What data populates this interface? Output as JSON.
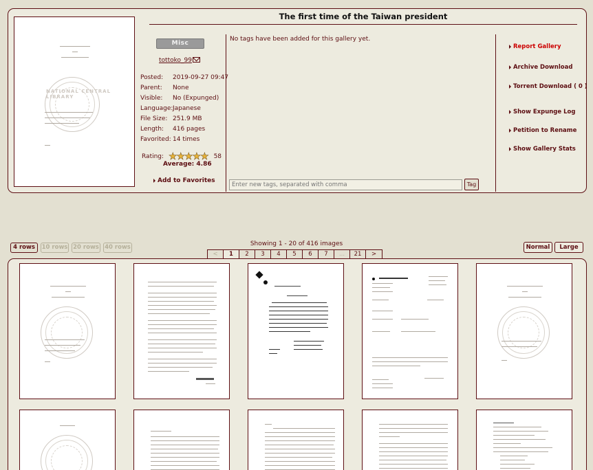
{
  "gallery": {
    "title": "The first time of the Taiwan president",
    "category": "Misc",
    "uploader": "tottoko_99",
    "meta": [
      {
        "key": "Posted:",
        "value": "2019-09-27 09:47"
      },
      {
        "key": "Parent:",
        "value": "None"
      },
      {
        "key": "Visible:",
        "value": "No (Expunged)"
      },
      {
        "key": "Language:",
        "value": "Japanese"
      },
      {
        "key": "File Size:",
        "value": "251.9 MB"
      },
      {
        "key": "Length:",
        "value": "416 pages"
      },
      {
        "key": "Favorited:",
        "value": "14 times"
      }
    ],
    "rating_label": "Rating:",
    "rating_count": "58",
    "rating_average": "Average: 4.86",
    "rating_stars": 4.86,
    "add_favorites": "Add to Favorites",
    "no_tags": "No tags have been added for this gallery yet.",
    "tag_placeholder": "Enter new tags, separated with comma",
    "tag_button": "Tag",
    "seal_text": "NATIONAL CENTRAL LIBRARY"
  },
  "actions": [
    {
      "label": "Report Gallery",
      "style": "red"
    },
    {
      "label": "Archive Download",
      "style": "normal"
    },
    {
      "label": "Torrent Download ( 0 )",
      "style": "normal"
    },
    {
      "label": "Show Expunge Log",
      "style": "normal"
    },
    {
      "label": "Petition to Rename",
      "style": "normal"
    },
    {
      "label": "Show Gallery Stats",
      "style": "normal"
    }
  ],
  "controls": {
    "rows": [
      "4 rows",
      "10 rows",
      "20 rows",
      "40 rows"
    ],
    "active_rows": "4 rows",
    "showing": "Showing 1 - 20 of 416 images",
    "pages": [
      "<",
      "1",
      "2",
      "3",
      "4",
      "5",
      "6",
      "7",
      "...",
      "21",
      ">"
    ],
    "current_page": "1",
    "size_normal": "Normal",
    "size_large": "Large"
  },
  "colors": {
    "background": "#e3e0d1",
    "panel": "#edebdf",
    "border": "#5c0d12",
    "text": "#5c0d11",
    "report_link": "#cc0000",
    "category_badge": "#9a9a9a"
  }
}
